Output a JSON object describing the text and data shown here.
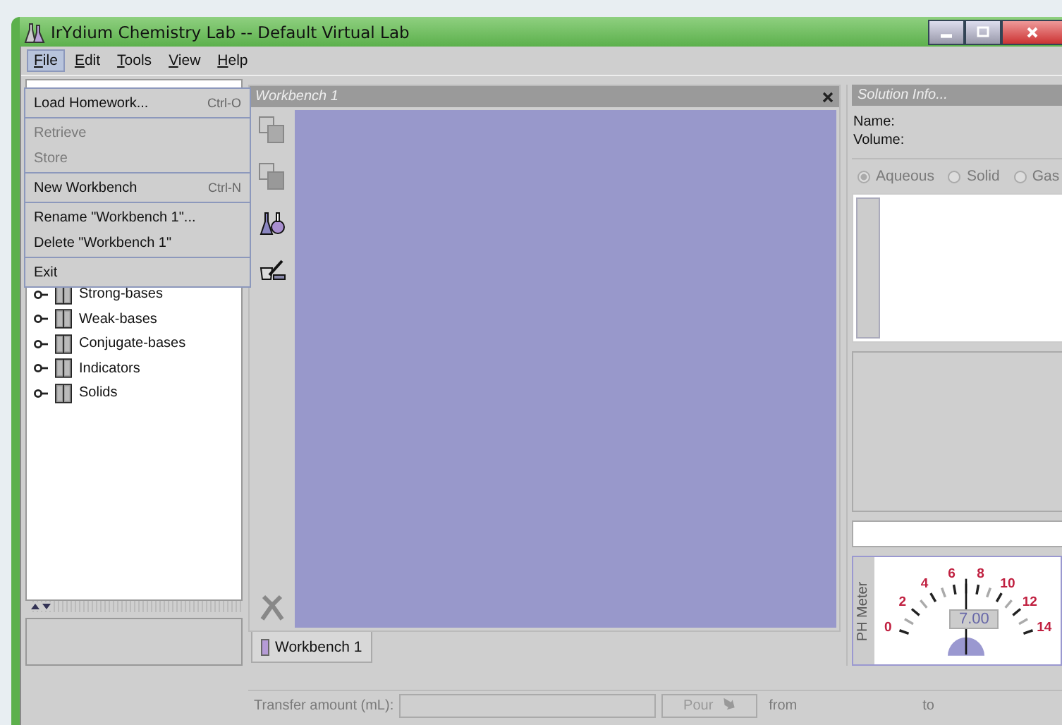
{
  "window": {
    "title": "IrYdium Chemistry Lab -- Default Virtual Lab"
  },
  "menu_bar": [
    {
      "label": "File",
      "selected": true
    },
    {
      "label": "Edit",
      "selected": false
    },
    {
      "label": "Tools",
      "selected": false
    },
    {
      "label": "View",
      "selected": false
    },
    {
      "label": "Help",
      "selected": false
    }
  ],
  "file_menu": {
    "groups": [
      {
        "items": [
          {
            "label": "Load Homework...",
            "shortcut": "Ctrl-O",
            "disabled": false
          }
        ]
      },
      {
        "items": [
          {
            "label": "Retrieve",
            "disabled": true
          },
          {
            "label": "Store",
            "disabled": true
          }
        ]
      },
      {
        "items": [
          {
            "label": "New Workbench",
            "shortcut": "Ctrl-N",
            "disabled": false
          }
        ]
      },
      {
        "items": [
          {
            "label": "Rename \"Workbench 1\"...",
            "disabled": false
          },
          {
            "label": "Delete \"Workbench 1\"",
            "disabled": false
          }
        ]
      },
      {
        "items": [
          {
            "label": "Exit",
            "disabled": false
          }
        ]
      }
    ]
  },
  "tree": {
    "items": [
      {
        "label": "Strong-bases"
      },
      {
        "label": "Weak-bases"
      },
      {
        "label": "Conjugate-bases"
      },
      {
        "label": "Indicators"
      },
      {
        "label": "Solids"
      }
    ]
  },
  "workbench": {
    "title": "Workbench 1",
    "tabs": [
      {
        "label": "Workbench 1",
        "selected": true
      }
    ]
  },
  "solution_info": {
    "title": "Solution Info...",
    "name_label": "Name:",
    "volume_label": "Volume:",
    "phases": [
      {
        "label": "Aqueous",
        "selected": true
      },
      {
        "label": "Solid",
        "selected": false
      },
      {
        "label": "Gas",
        "selected": false
      }
    ]
  },
  "ph_meter": {
    "label": "PH Meter",
    "reading": "7.00",
    "level": 0.5,
    "scale": [
      "0",
      "2",
      "4",
      "6",
      "8",
      "10",
      "12",
      "14"
    ]
  },
  "status_bar": {
    "transfer_label": "Transfer amount (mL):",
    "pour_button": "Pour",
    "from_label": "from",
    "to_label": "to"
  }
}
